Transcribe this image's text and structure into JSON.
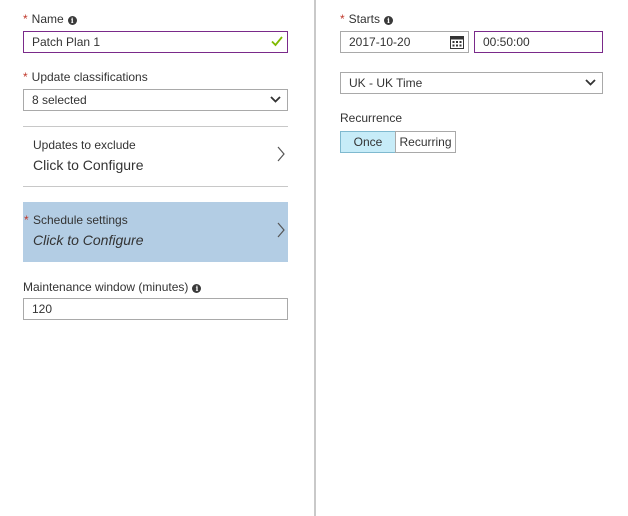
{
  "left": {
    "name": {
      "label": "Name",
      "value": "Patch Plan 1"
    },
    "classifications": {
      "label": "Update classifications",
      "value": "8 selected"
    },
    "exclude": {
      "title": "Updates to exclude",
      "subtitle": "Click to Configure"
    },
    "schedule": {
      "title": "Schedule settings",
      "subtitle": "Click to Configure"
    },
    "maintenance": {
      "label": "Maintenance window (minutes)",
      "value": "120"
    }
  },
  "right": {
    "starts": {
      "label": "Starts",
      "date": "2017-10-20",
      "time": "00:50:00"
    },
    "timezone": {
      "value": "UK - UK Time"
    },
    "recurrence": {
      "label": "Recurrence",
      "options": [
        "Once",
        "Recurring"
      ],
      "selected": "Once"
    }
  },
  "colors": {
    "required": "#c0392b",
    "focus_border": "#7a2a8a",
    "valid_check": "#7fba00",
    "schedule_bg": "#b3cde4",
    "active_segment": "#c7ecf8"
  },
  "icons": [
    "info-icon",
    "check-icon",
    "chevron-down-icon",
    "chevron-right-icon",
    "calendar-icon"
  ]
}
